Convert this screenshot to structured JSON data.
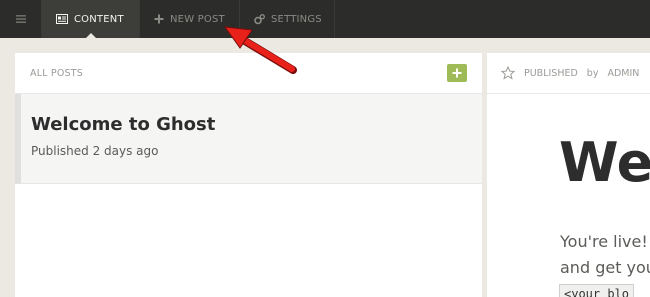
{
  "nav": {
    "menu_icon": "menu-icon",
    "tabs": [
      {
        "label": "CONTENT",
        "icon": "content-icon",
        "active": true
      },
      {
        "label": "NEW POST",
        "icon": "plus-icon",
        "active": false
      },
      {
        "label": "SETTINGS",
        "icon": "gear-icon",
        "active": false
      }
    ]
  },
  "post_list": {
    "header": "ALL POSTS",
    "add_icon": "plus-icon",
    "posts": [
      {
        "title": "Welcome to Ghost",
        "meta": "Published 2 days ago"
      }
    ]
  },
  "preview": {
    "star_icon": "star-icon",
    "status": "PUBLISHED",
    "by": "by",
    "author": "ADMIN",
    "title": "We",
    "text_line1": "You're live!",
    "text_line2": "and get you",
    "code": "<your blo"
  },
  "colors": {
    "topbar": "#2c2c2a",
    "accent_green": "#9fbb58",
    "annotation_arrow": "#e8221b"
  }
}
